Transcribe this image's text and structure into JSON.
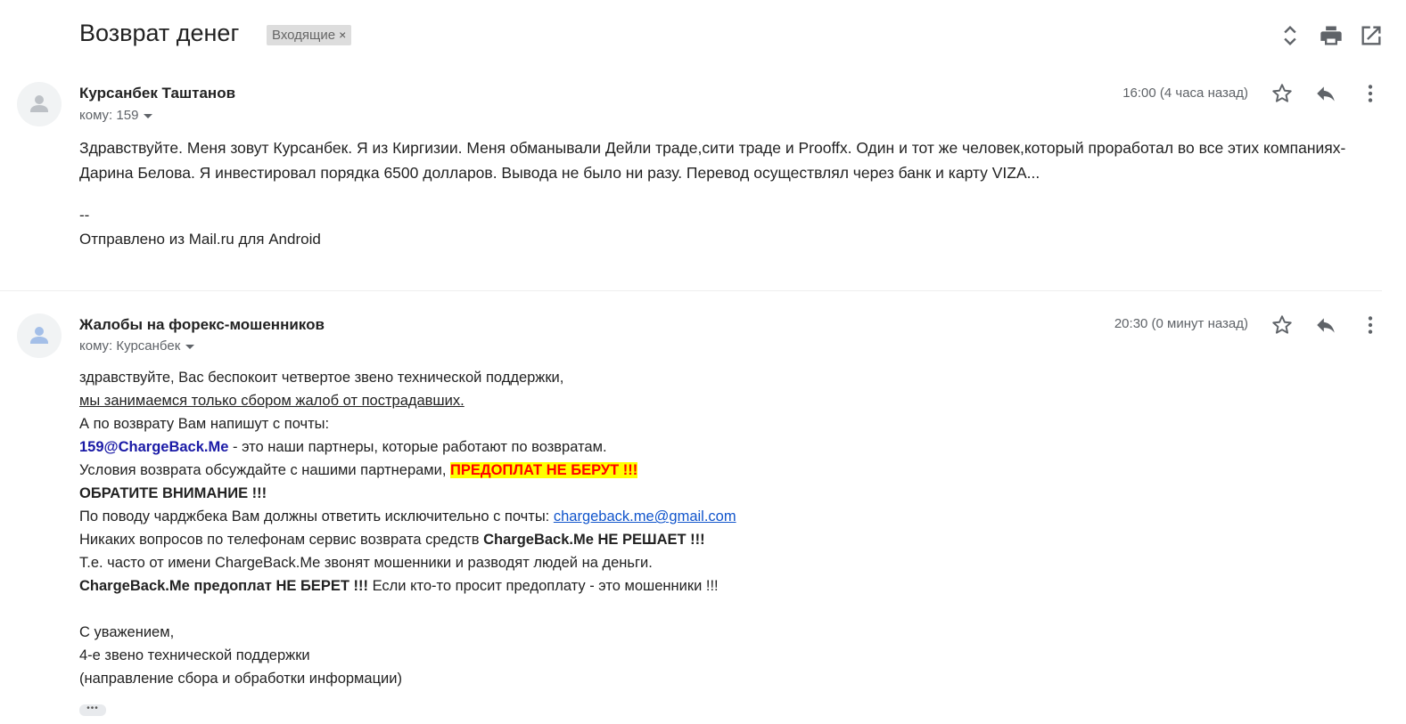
{
  "thread": {
    "subject": "Возврат денег",
    "label": "Входящие",
    "label_close": "×"
  },
  "header_icons": [
    "expand-collapse-icon",
    "print-icon",
    "open-new-window-icon"
  ],
  "messages": [
    {
      "sender": "Курсанбек Таштанов",
      "recipient": "кому: 159",
      "time": "16:00 (4 часа назад)",
      "body": "Здравствуйте. Меня зовут Курсанбек. Я из Киргизии. Меня обманывали Дейли траде,сити траде и Prooffx. Один и тот же человек,который проработал во все этих компаниях-Дарина Белова. Я инвестировал порядка 6500 долларов. Вывода не было ни разу. Перевод осуществлял через банк и карту VIZA...",
      "signature_sep": "--",
      "signature": "Отправлено из Mail.ru для Android"
    },
    {
      "sender": "Жалобы на форекс-мошенников",
      "recipient": "кому: Курсанбек",
      "time": "20:30 (0 минут назад)",
      "lines": {
        "l1": "здравствуйте, Вас беспокоит четвертое звено технической поддержки,",
        "l2": "мы занимаемся только сбором жалоб от пострадавших.",
        "l3": "А по возврату Вам напишут с почты:",
        "l4_email": "159@ChargeBack.Me",
        "l4_rest": " - это наши партнеры, которые работают по возвратам.",
        "l5_text": "Условия возврата обсуждайте с нашими партнерами, ",
        "l5_highlight": "ПРЕДОПЛАТ НЕ БЕРУТ !!!",
        "l6": "ОБРАТИТЕ ВНИМАНИЕ !!!",
        "l7_text": "По поводу чарджбека Вам должны ответить исключительно с почты: ",
        "l7_link": "chargeback.me@gmail.com",
        "l8_text": "Никаких вопросов по телефонам сервис возврата средств ",
        "l8_bold": "ChargeBack.Me НЕ РЕШАЕТ !!!",
        "l9": "Т.е. часто от имени ChargeBack.Me звонят мошенники и разводят людей на деньги.",
        "l10_bold": "ChargeBack.Me предоплат НЕ БЕРЕТ !!!",
        "l10_rest": " Если кто-то просит предоплату - это мошенники !!!",
        "closing1": "С уважением,",
        "closing2": "4-е звено технической поддержки",
        "closing3": "(направление сбора и обработки информации)"
      },
      "more": "•••"
    }
  ]
}
